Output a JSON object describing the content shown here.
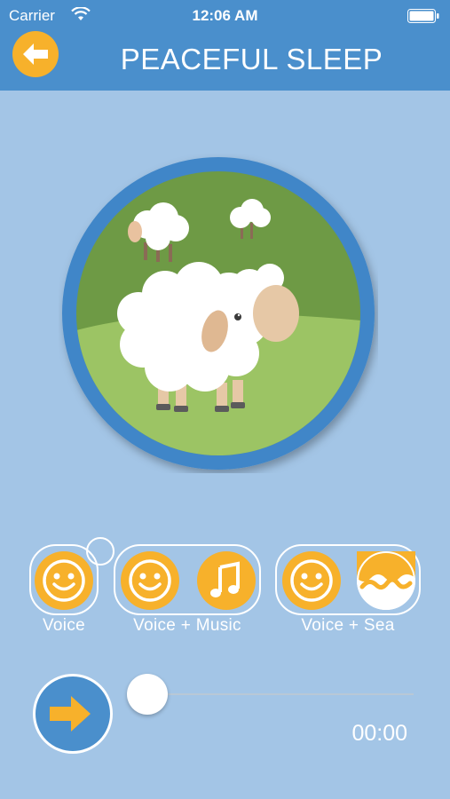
{
  "status_bar": {
    "carrier": "Carrier",
    "time": "12:06 AM"
  },
  "header": {
    "title": "PEACEFUL SLEEP",
    "back_icon": "arrow-left-icon"
  },
  "colors": {
    "header_bg": "#4a8fcc",
    "page_bg": "#a3c5e6",
    "accent": "#f7b12b",
    "grass_dark": "#6e9a45",
    "grass_light": "#9cc464"
  },
  "modes": [
    {
      "label": "Voice",
      "icons": [
        "smiley-icon"
      ]
    },
    {
      "label": "Voice + Music",
      "icons": [
        "smiley-icon",
        "music-note-icon"
      ]
    },
    {
      "label": "Voice + Sea",
      "icons": [
        "smiley-icon",
        "wave-icon"
      ]
    }
  ],
  "player": {
    "play_icon": "arrow-right-icon",
    "elapsed": "00:00",
    "progress": 0
  }
}
